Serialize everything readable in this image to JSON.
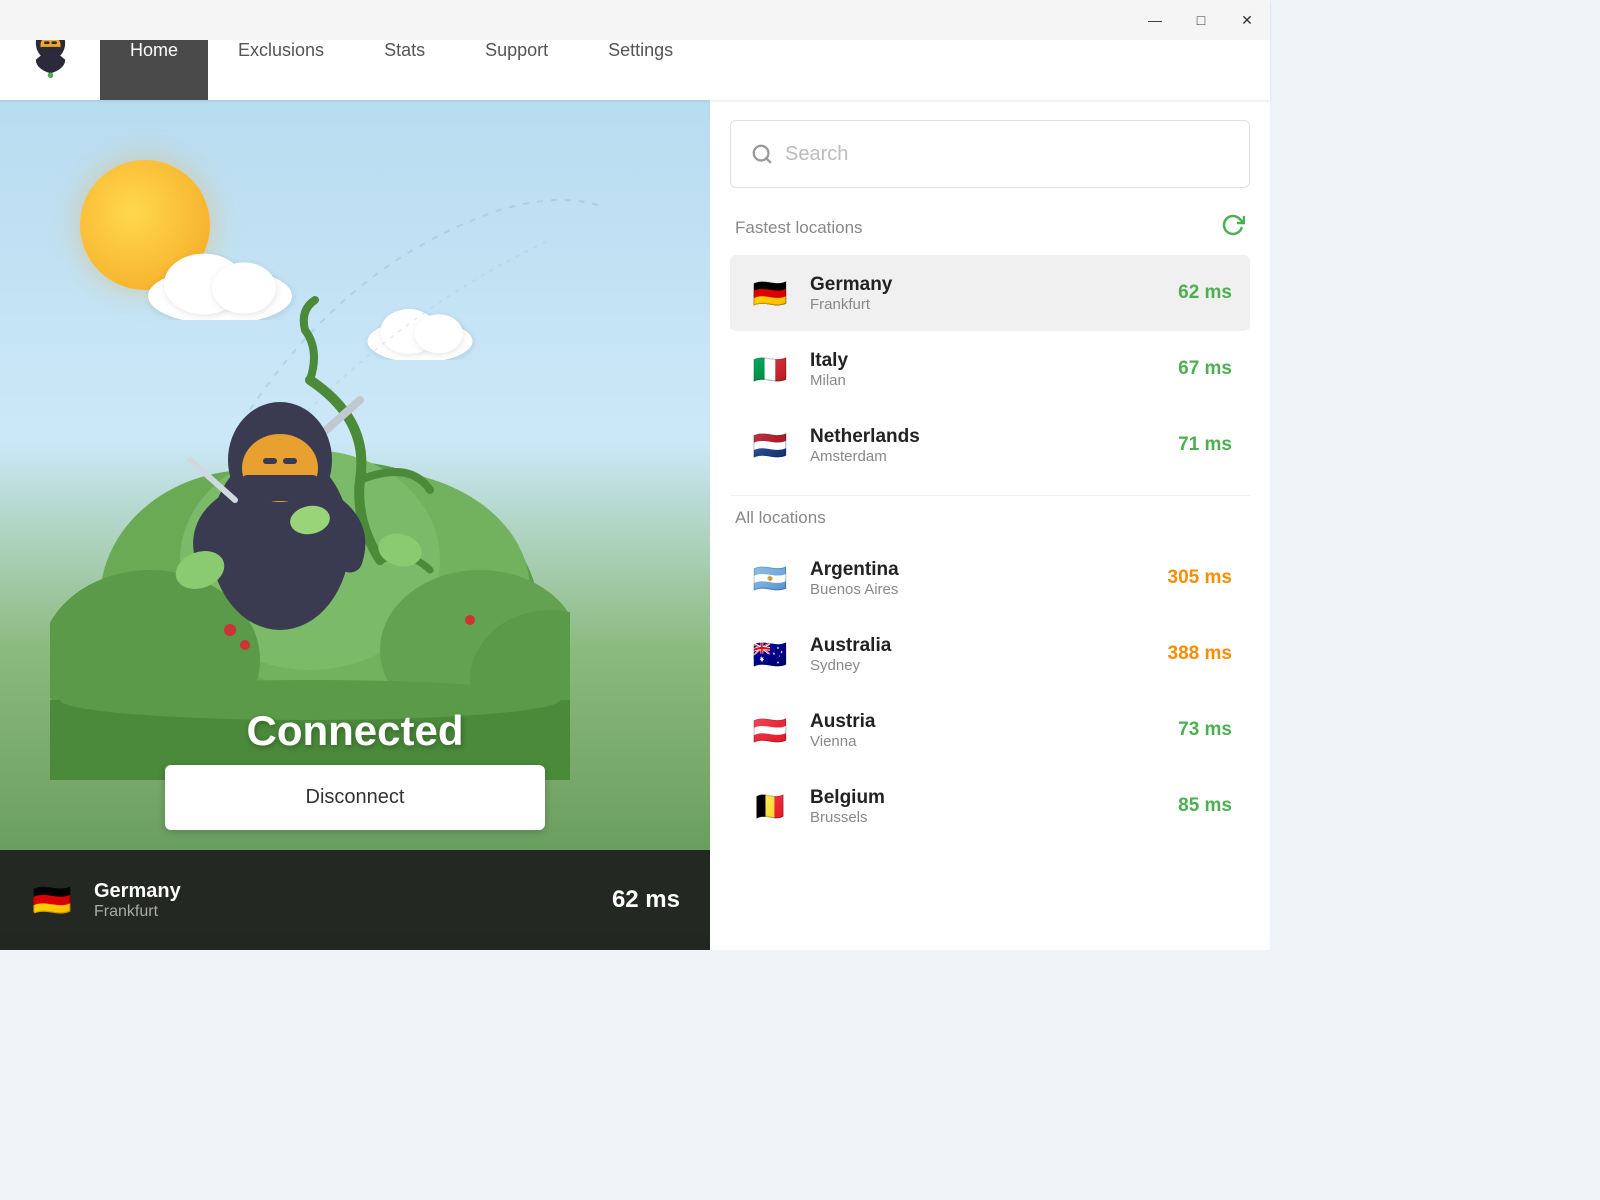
{
  "titlebar": {
    "minimize_label": "—",
    "maximize_label": "□",
    "close_label": "✕"
  },
  "navbar": {
    "logo_alt": "TorGuard Ninja Logo",
    "items": [
      {
        "id": "home",
        "label": "Home",
        "active": true
      },
      {
        "id": "exclusions",
        "label": "Exclusions",
        "active": false
      },
      {
        "id": "stats",
        "label": "Stats",
        "active": false
      },
      {
        "id": "support",
        "label": "Support",
        "active": false
      },
      {
        "id": "settings",
        "label": "Settings",
        "active": false
      }
    ]
  },
  "left_panel": {
    "status": "Connected",
    "disconnect_label": "Disconnect",
    "current_connection": {
      "country": "Germany",
      "city": "Frankfurt",
      "ping": "62 ms",
      "flag_emoji": "🇩🇪"
    }
  },
  "right_panel": {
    "search": {
      "placeholder": "Search"
    },
    "sections": [
      {
        "title": "Fastest locations",
        "show_refresh": true,
        "locations": [
          {
            "country": "Germany",
            "city": "Frankfurt",
            "ping": "62 ms",
            "ping_type": "green",
            "flag": "🇩🇪",
            "selected": true
          },
          {
            "country": "Italy",
            "city": "Milan",
            "ping": "67 ms",
            "ping_type": "green",
            "flag": "🇮🇹",
            "selected": false
          },
          {
            "country": "Netherlands",
            "city": "Amsterdam",
            "ping": "71 ms",
            "ping_type": "green",
            "flag": "🇳🇱",
            "selected": false
          }
        ]
      },
      {
        "title": "All locations",
        "show_refresh": false,
        "locations": [
          {
            "country": "Argentina",
            "city": "Buenos Aires",
            "ping": "305 ms",
            "ping_type": "orange",
            "flag": "🇦🇷",
            "selected": false
          },
          {
            "country": "Australia",
            "city": "Sydney",
            "ping": "388 ms",
            "ping_type": "orange",
            "flag": "🇦🇺",
            "selected": false
          },
          {
            "country": "Austria",
            "city": "Vienna",
            "ping": "73 ms",
            "ping_type": "green",
            "flag": "🇦🇹",
            "selected": false
          },
          {
            "country": "Belgium",
            "city": "Brussels",
            "ping": "85 ms",
            "ping_type": "green",
            "flag": "🇧🇪",
            "selected": false
          }
        ]
      }
    ]
  },
  "colors": {
    "accent_green": "#4caf50",
    "accent_orange": "#ff8c00",
    "nav_active_bg": "#4a4a4a",
    "connected_bg": "rgba(30,30,30,0.92)"
  }
}
